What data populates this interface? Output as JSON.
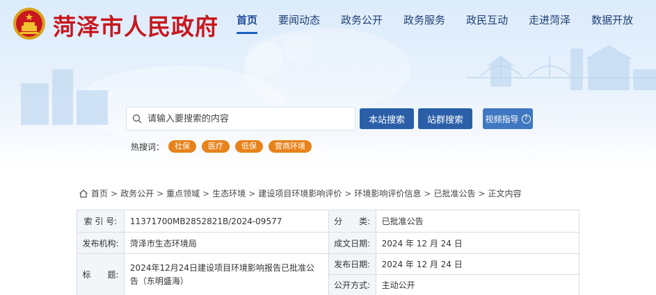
{
  "header": {
    "title": "菏泽市人民政府",
    "nav": [
      "首页",
      "要闻动态",
      "政务公开",
      "政务服务",
      "政民互动",
      "走进菏泽",
      "数据开放"
    ],
    "active_nav": 0
  },
  "search": {
    "placeholder": "请输入要搜索的内容",
    "site_button": "本站搜索",
    "group_button": "站群搜索",
    "video_button": "视频指导"
  },
  "hot": {
    "label": "热搜词：",
    "tags": [
      "社保",
      "医疗",
      "低保",
      "营商环境"
    ]
  },
  "breadcrumb": [
    "首页",
    "政务公开",
    "重点领域",
    "生态环境",
    "建设项目环境影响评价",
    "环境影响评价信息",
    "已批准公告",
    "正文内容"
  ],
  "info": {
    "index_label": "索 引 号:",
    "index_value": "11371700MB2852821B/2024-09577",
    "category_label": "分　　类:",
    "category_value": "已批准公告",
    "publisher_label": "发布机构:",
    "publisher_value": "菏泽市生态环境局",
    "created_label": "成文日期:",
    "created_value": "2024 年 12 月 24 日",
    "title_label": "标　　题:",
    "title_value": "2024年12月24日建设项目环境影响报告已批准公告（东明盛海）",
    "published_label": "发布日期:",
    "published_value": "2024 年 12 月 24 日",
    "disclosure_label": "公开方式:",
    "disclosure_value": "主动公开"
  },
  "colors": {
    "brand_red": "#c8171e",
    "nav_blue": "#1f3f74",
    "button_blue": "#2a5fa8",
    "tag_orange": "#e8821a"
  }
}
